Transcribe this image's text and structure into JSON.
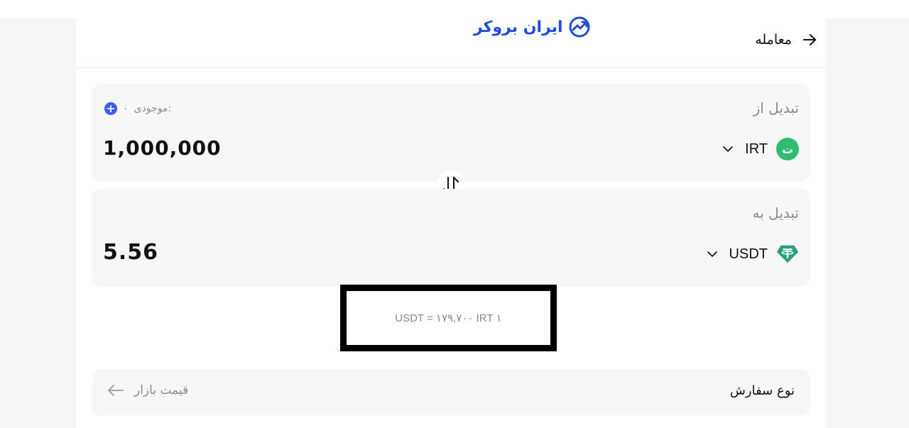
{
  "header": {
    "logo_text": "ایران بروکر",
    "back_label": "معامله"
  },
  "from_card": {
    "title": "تبدیل از",
    "balance_label": "موجودی:",
    "balance_value": "۰",
    "amount": "1,000,000",
    "currency_code": "IRT",
    "currency_symbol": "ت",
    "currency_color": "#2ebd6e"
  },
  "to_card": {
    "title": "تبدیل به",
    "amount": "5.56",
    "currency_code": "USDT",
    "currency_color": "#26a17b"
  },
  "rate": {
    "text": "۱ USDT = ۱۷۹,۷۰۰ IRT"
  },
  "order": {
    "title": "نوع سفارش",
    "value": "قیمت بازار"
  },
  "colors": {
    "brand": "#1f4fd8",
    "accent": "#3d5cf5",
    "card_bg": "#f7f7f7"
  }
}
